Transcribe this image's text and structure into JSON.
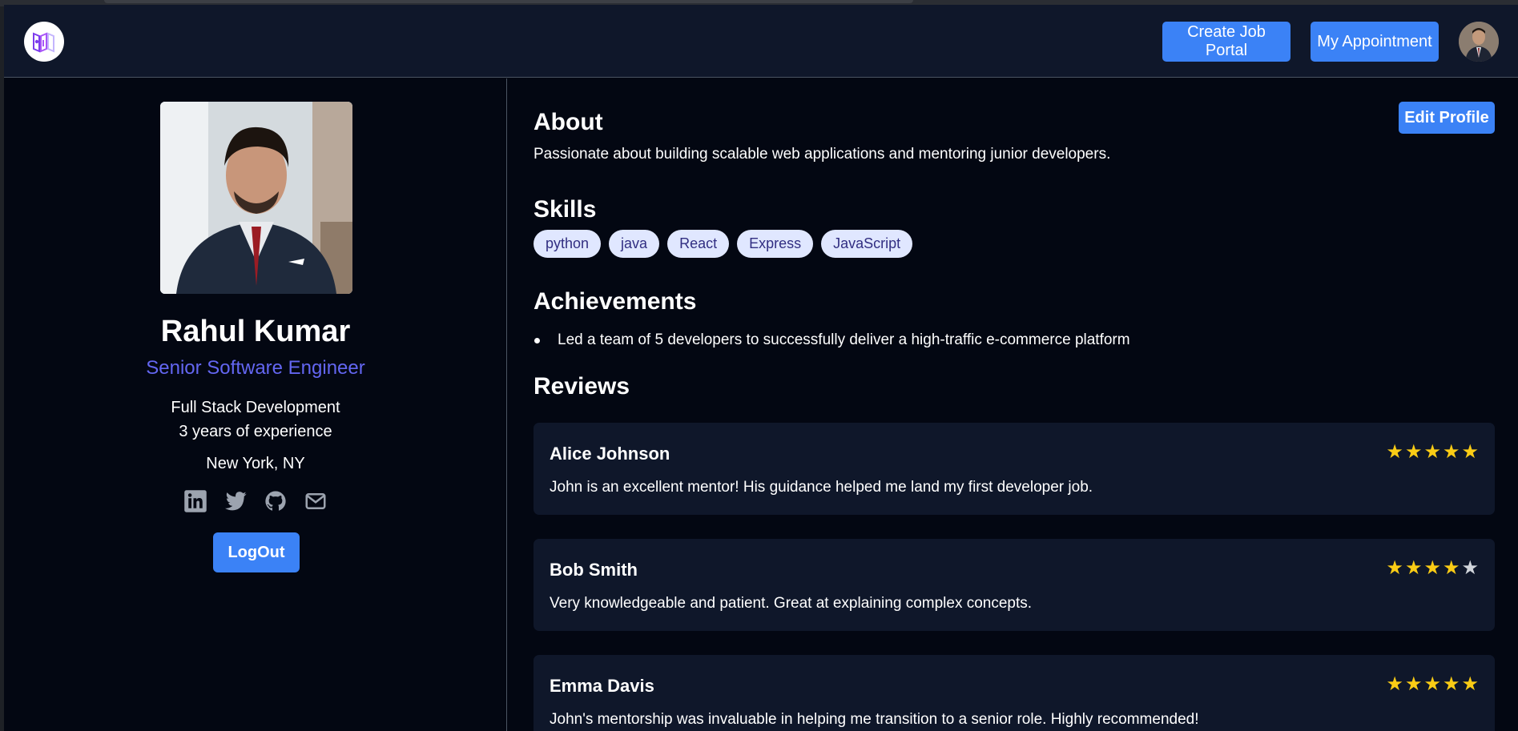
{
  "header": {
    "create_job_portal": "Create Job Portal",
    "my_appointment": "My Appointment"
  },
  "profile": {
    "name": "Rahul Kumar",
    "title": "Senior Software Engineer",
    "specialty": "Full Stack Development",
    "experience": "3 years of experience",
    "location": "New York, NY",
    "logout_label": "LogOut",
    "socials": [
      "linkedin-icon",
      "twitter-icon",
      "github-icon",
      "mail-icon"
    ]
  },
  "main": {
    "edit_profile_label": "Edit Profile",
    "about": {
      "heading": "About",
      "text": "Passionate about building scalable web applications and mentoring junior developers."
    },
    "skills": {
      "heading": "Skills",
      "items": [
        "python",
        "java",
        "React",
        "Express",
        "JavaScript"
      ]
    },
    "achievements": {
      "heading": "Achievements",
      "items": [
        "Led a team of 5 developers to successfully deliver a high-traffic e-commerce platform"
      ]
    },
    "reviews": {
      "heading": "Reviews",
      "items": [
        {
          "name": "Alice Johnson",
          "rating": 5,
          "text": "John is an excellent mentor! His guidance helped me land my first developer job."
        },
        {
          "name": "Bob Smith",
          "rating": 4,
          "text": "Very knowledgeable and patient. Great at explaining complex concepts."
        },
        {
          "name": "Emma Davis",
          "rating": 5,
          "text": "John's mentorship was invaluable in helping me transition to a senior role. Highly recommended!"
        }
      ]
    }
  },
  "colors": {
    "accent": "#3b82f6",
    "role_text": "#6366f1",
    "star_on": "#facc15",
    "star_off": "#d1d5db",
    "background": "#030712",
    "card": "#0f172a"
  }
}
